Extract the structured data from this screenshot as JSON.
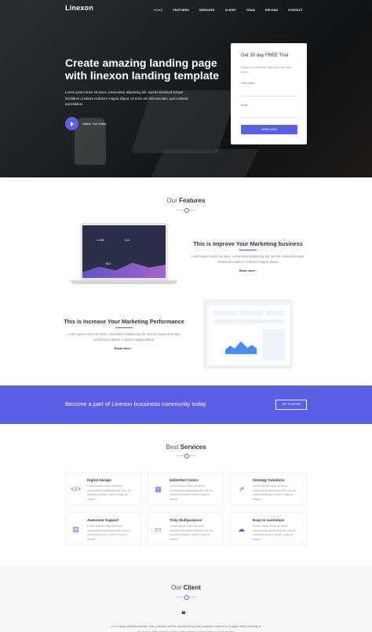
{
  "brand": {
    "accent": "#5b5fe6",
    "logo": "Linexon"
  },
  "nav": [
    "HOME",
    "FEATURES",
    "SERVICES",
    "CLIENT",
    "TEAM",
    "PRICING",
    "CONTACT"
  ],
  "hero": {
    "title": "Create amazing landing page with linexon landing template",
    "text": "Lorem ipsum dolor sit amet, consectetur adipiscing elit, sed do eiusmod tempor incididunt ut labore et dolore magna aliqua. Ut enim ad minimveniam, quis nostrud exercitation.",
    "video_label": "Watch The Video"
  },
  "trial": {
    "title": "Get 30 day FREE Trial",
    "subtitle": "Enjoy your website, filled with the care about.",
    "first_name_label": "First Name",
    "email_label": "Email",
    "send_label": "SEND DATA"
  },
  "features": {
    "title_light": "Our",
    "title_bold": "Features",
    "laptop_numbers": [
      "1,281",
      "4.6",
      "821"
    ],
    "items": [
      {
        "title": "This is Improve Your Marketing business",
        "text": "Lorem ipsum dolor sit amet, consectetur adipiscing elit, sed do eiusmod tempor incididunt ut labore et dolore magna aliqua.",
        "link": "Read more ›"
      },
      {
        "title": "This Is Increase Your Marketing Performance",
        "text": "Lorem ipsum dolor sit amet, consectetur adipiscing elit, sed do eiusmod tempor incididunt ut labore et dolore magna aliqua.",
        "link": "Read more ›"
      }
    ]
  },
  "banner": {
    "text": "Become a part of Linexon bussiness community today",
    "button": "GET STARTED"
  },
  "services": {
    "title_light": "Best",
    "title_bold": "Services",
    "items": [
      {
        "icon": "code-icon",
        "glyph": "</>",
        "title": "Digital Design",
        "text": "Lorem ipsum dolor sit amet, consectetur adipiscing elit, sed do eiusmod tempor dolore mag na aliqua."
      },
      {
        "icon": "grid-icon",
        "glyph": "▦",
        "title": "Unlimited Colors",
        "text": "Lorem ipsum dolor sit amet, consectetur adipiscing elit, sed do eiusmod tempor dolore mag na aliqua."
      },
      {
        "icon": "chart-icon",
        "glyph": "↗",
        "title": "Strategy Solutions",
        "text": "Lorem ipsum dolor sit amet, consectetur adipiscing elit, sed do eiusmod tempor dolore mag na aliqua."
      },
      {
        "icon": "document-icon",
        "glyph": "▤",
        "title": "Awesome Support",
        "text": "Lorem ipsum dolor sit amet, consectetur adipiscing elit, sed do eiusmod tempor dolore mag na aliqua."
      },
      {
        "icon": "monitor-icon",
        "glyph": "▭",
        "title": "Truly Multipurpose",
        "text": "Lorem ipsum dolor sit amet, consectetur adipiscing elit, sed do eiusmod tempor dolore mag na aliqua."
      },
      {
        "icon": "cloud-icon",
        "glyph": "☁",
        "title": "Easy to customize",
        "text": "Lorem ipsum dolor sit amet, consectetur adipiscing elit, sed do eiusmod tempor dolore mag na aliqua."
      }
    ]
  },
  "client": {
    "title_light": "Our",
    "title_bold": "Client",
    "quote": "It is a long established fact that a reader will be distracted by the readable content of a page when looking at its layout. The point of using Lorem Ipsum is that it has a more-or-less"
  }
}
